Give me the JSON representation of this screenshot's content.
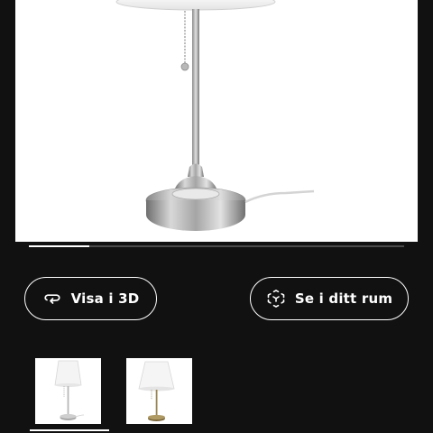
{
  "gallery": {
    "main_image": "table-lamp-nickel-white-shade",
    "slide_progress": 0.16,
    "thumbnails": [
      {
        "name": "lamp-nickel-thumbnail",
        "selected": true
      },
      {
        "name": "lamp-brass-thumbnail",
        "selected": false
      }
    ]
  },
  "actions": {
    "view_3d": {
      "label": "Visa i 3D",
      "icon": "rotate-3d-icon"
    },
    "ar_view": {
      "label": "Se i ditt rum",
      "icon": "ar-cube-icon"
    }
  },
  "colors": {
    "background": "#111111",
    "foreground": "#ffffff",
    "track": "#4a4a4a"
  }
}
